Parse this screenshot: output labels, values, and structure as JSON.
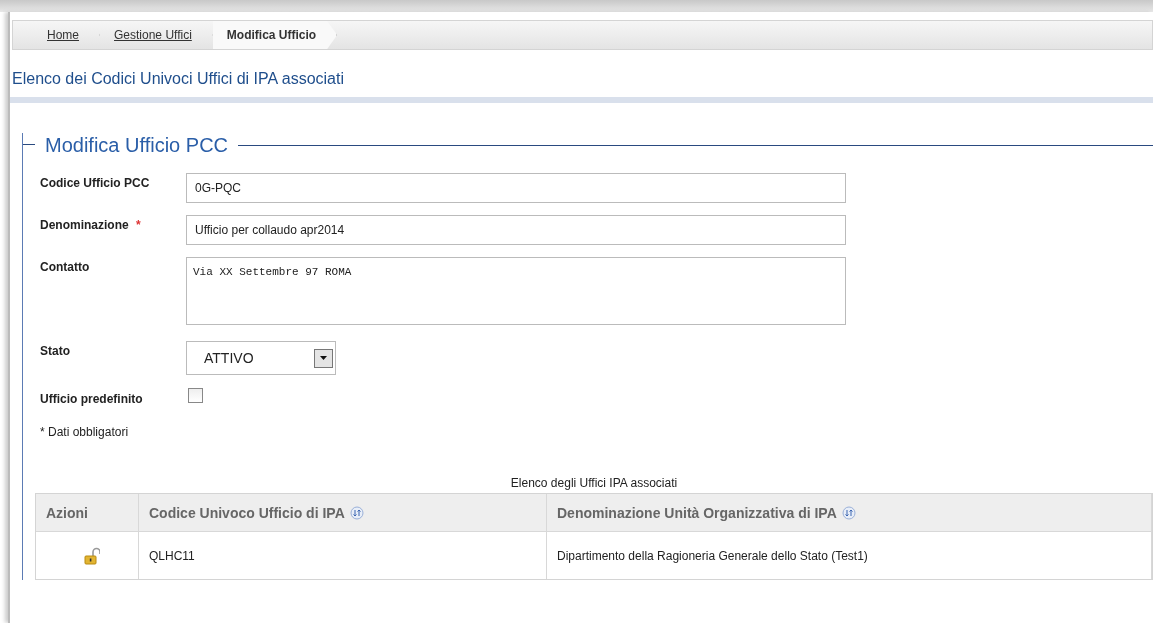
{
  "breadcrumb": [
    {
      "label": "Home",
      "selected": false
    },
    {
      "label": "Gestione Uffici",
      "selected": false
    },
    {
      "label": "Modifica Ufficio",
      "selected": true
    }
  ],
  "page_title": "Elenco dei Codici Univoci Uffici di IPA associati",
  "form": {
    "legend": "Modifica Ufficio PCC",
    "fields": [
      {
        "kind": "text",
        "label": "Codice Ufficio PCC",
        "required": false,
        "value": "0G-PQC"
      },
      {
        "kind": "text",
        "label": "Denominazione",
        "required": true,
        "value": "Ufficio per collaudo apr2014"
      },
      {
        "kind": "textarea",
        "label": "Contatto",
        "required": false,
        "value": "Via XX Settembre 97 ROMA"
      },
      {
        "kind": "select",
        "label": "Stato",
        "required": false,
        "value": "ATTIVO"
      },
      {
        "kind": "checkbox",
        "label": "Ufficio predefinito",
        "required": false,
        "checked": false
      }
    ],
    "required_mark": "*",
    "required_note": "* Dati obbligatori"
  },
  "table": {
    "caption": "Elenco degli Uffici IPA associati",
    "columns": [
      {
        "label": "Azioni",
        "sortable": false
      },
      {
        "label": "Codice Univoco Ufficio di IPA",
        "sortable": true
      },
      {
        "label": "Denominazione Unità Organizzativa di IPA",
        "sortable": true
      }
    ],
    "rows": [
      {
        "locked": false,
        "code": "QLHC11",
        "name": "Dipartimento della Ragioneria Generale dello Stato (Test1)"
      }
    ]
  }
}
